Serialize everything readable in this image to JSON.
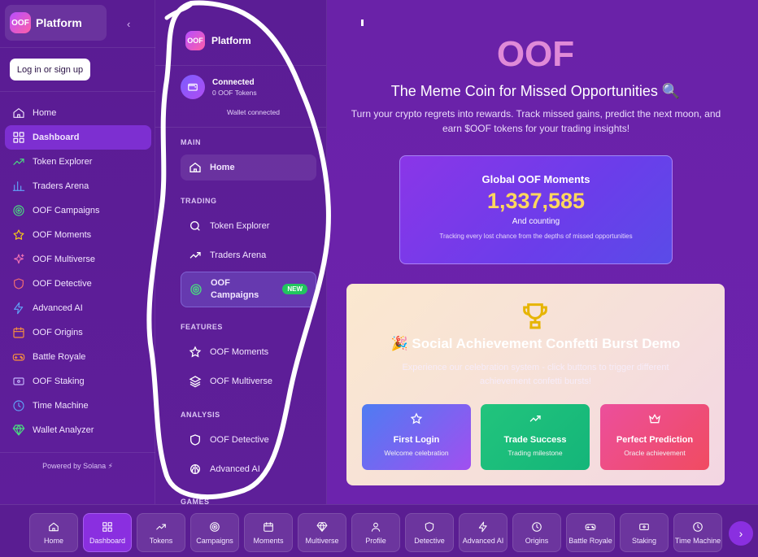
{
  "sidebar": {
    "brand_logo": "OOF",
    "brand_title": "Platform",
    "collapse_icon": "chevron-left-icon",
    "login_label": "Log in or sign up",
    "items": [
      {
        "label": "Home",
        "icon": "home-icon"
      },
      {
        "label": "Dashboard",
        "icon": "dashboard-icon",
        "active": true
      },
      {
        "label": "Token Explorer",
        "icon": "trending-icon"
      },
      {
        "label": "Traders Arena",
        "icon": "bar-chart-icon"
      },
      {
        "label": "OOF Campaigns",
        "icon": "target-icon"
      },
      {
        "label": "OOF Moments",
        "icon": "star-icon"
      },
      {
        "label": "OOF Multiverse",
        "icon": "sparkle-icon"
      },
      {
        "label": "OOF Detective",
        "icon": "shield-icon"
      },
      {
        "label": "Advanced AI",
        "icon": "bolt-icon"
      },
      {
        "label": "OOF Origins",
        "icon": "calendar-icon"
      },
      {
        "label": "Battle Royale",
        "icon": "gamepad-icon"
      },
      {
        "label": "OOF Staking",
        "icon": "ticket-icon"
      },
      {
        "label": "Time Machine",
        "icon": "clock-icon"
      },
      {
        "label": "Wallet Analyzer",
        "icon": "gem-icon"
      }
    ],
    "powered_by": "Powered by Solana ⚡"
  },
  "mid_panel": {
    "brand_logo": "OOF",
    "brand_title": "Platform",
    "wallet_title": "Connected",
    "wallet_tokens": "0 OOF Tokens",
    "wallet_status": "Wallet connected",
    "section_main": "MAIN",
    "home_label": "Home",
    "section_trading": "TRADING",
    "token_explorer": "Token Explorer",
    "traders_arena": "Traders Arena",
    "campaigns_line1": "OOF",
    "campaigns_line2": "Campaigns",
    "new_badge": "NEW",
    "section_features": "FEATURES",
    "moments": "OOF Moments",
    "multiverse": "OOF Multiverse",
    "section_analysis": "ANALYSIS",
    "detective": "OOF Detective",
    "advanced_ai": "Advanced AI",
    "section_games_partial": "GAMES"
  },
  "hero": {
    "title": "OOF",
    "subtitle": "The Meme Coin for Missed Opportunities 🔍",
    "description": "Turn your crypto regrets into rewards. Track missed gains, predict the next moon, and earn $OOF tokens for your trading insights!"
  },
  "moments_card": {
    "title": "Global OOF Moments",
    "count": "1,337,585",
    "caption": "And counting",
    "note": "Tracking every lost chance from the depths of missed opportunities"
  },
  "confetti_card": {
    "title": "🎉 Social Achievement Confetti Burst Demo",
    "description": "Experience our celebration system - click buttons to trigger different achievement confetti bursts!",
    "buttons": [
      {
        "title": "First Login",
        "sub": "Welcome celebration",
        "icon": "star-icon"
      },
      {
        "title": "Trade Success",
        "sub": "Trading milestone",
        "icon": "trending-icon"
      },
      {
        "title": "Perfect Prediction",
        "sub": "Oracle achievement",
        "icon": "crown-icon"
      }
    ]
  },
  "tabbar": {
    "tabs": [
      {
        "label": "Home",
        "icon": "home-icon"
      },
      {
        "label": "Dashboard",
        "icon": "dashboard-icon",
        "active": true
      },
      {
        "label": "Tokens",
        "icon": "trending-icon"
      },
      {
        "label": "Campaigns",
        "icon": "target-icon"
      },
      {
        "label": "Moments",
        "icon": "calendar-icon"
      },
      {
        "label": "Multiverse",
        "icon": "gem-icon"
      },
      {
        "label": "Profile",
        "icon": "user-icon"
      },
      {
        "label": "Detective",
        "icon": "shield-icon"
      },
      {
        "label": "Advanced AI",
        "icon": "bolt-icon"
      },
      {
        "label": "Origins",
        "icon": "clock-icon"
      },
      {
        "label": "Battle Royale",
        "icon": "gamepad-icon"
      },
      {
        "label": "Staking",
        "icon": "ticket-icon"
      },
      {
        "label": "Time Machine",
        "icon": "clock-icon"
      }
    ],
    "next_icon": "chevron-right-icon"
  },
  "colors": {
    "accent": "#8a2fe0",
    "hero_title": "#e08ad8",
    "count": "#ffd75e",
    "new_badge": "#22c55e"
  }
}
